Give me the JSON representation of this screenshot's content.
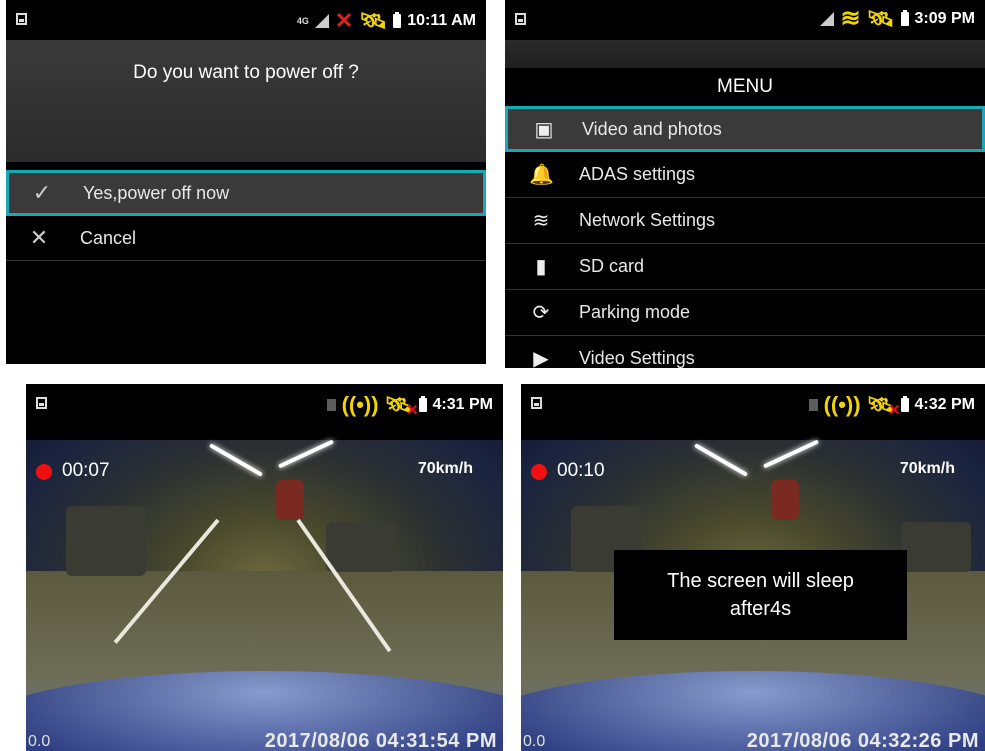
{
  "panel1": {
    "status": {
      "time": "10:11 AM"
    },
    "question": "Do you want to power off ?",
    "options": [
      {
        "label": "Yes,power off now",
        "icon": "check-icon"
      },
      {
        "label": "Cancel",
        "icon": "close-icon"
      }
    ]
  },
  "panel2": {
    "status": {
      "time": "3:09 PM"
    },
    "title": "MENU",
    "items": [
      {
        "label": "Video and photos",
        "icon": "video-library-icon"
      },
      {
        "label": "ADAS settings",
        "icon": "bell-icon"
      },
      {
        "label": "Network Settings",
        "icon": "wifi-icon"
      },
      {
        "label": "SD card",
        "icon": "sd-card-icon"
      },
      {
        "label": "Parking mode",
        "icon": "sync-icon"
      },
      {
        "label": "Video Settings",
        "icon": "video-settings-icon"
      }
    ]
  },
  "panel3": {
    "status": {
      "time": "4:31 PM"
    },
    "rec_time": "00:07",
    "speed": "70km/h",
    "corner": "0.0",
    "timestamp": "2017/08/06 04:31:54 PM"
  },
  "panel4": {
    "status": {
      "time": "4:32 PM"
    },
    "rec_time": "00:10",
    "speed": "70km/h",
    "toast_line1": "The screen will sleep",
    "toast_line2": "after4s",
    "corner": "0.0",
    "timestamp": "2017/08/06 04:32:26 PM"
  },
  "colors": {
    "highlight": "#1aa8b8",
    "gps": "#f2d400",
    "record": "#f01010"
  }
}
